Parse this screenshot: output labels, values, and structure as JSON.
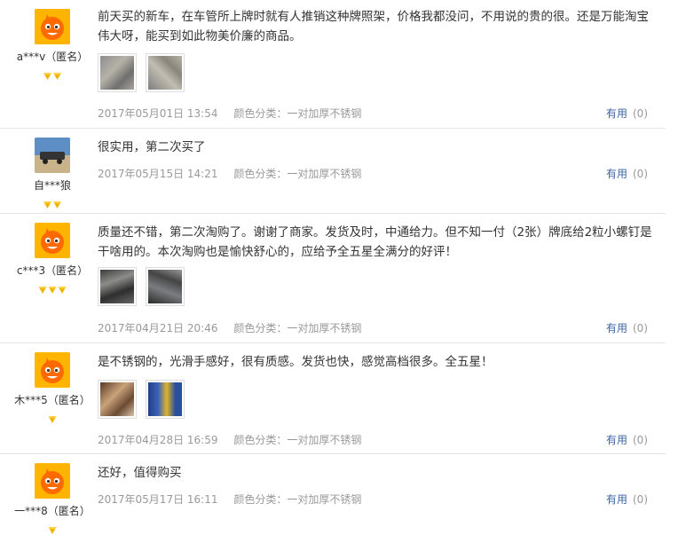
{
  "reviews": [
    {
      "nick": "a***v（匿名）",
      "avatar": "taobao-doll-avatar",
      "level": 2,
      "text": "前天买的新车，在车管所上牌时就有人推销这种牌照架，价格我都没问，不用说的贵的很。还是万能淘宝伟大呀，能买到如此物美价廉的商品。",
      "date": "2017年05月01日 13:54",
      "sku": "颜色分类：一对加厚不锈钢",
      "useful_label": "有用",
      "useful_count": "(0)",
      "images": [
        "grey",
        "grey"
      ]
    },
    {
      "nick": "自***狼",
      "avatar": "car-photo-avatar",
      "level": 2,
      "text": "很实用，第二次买了",
      "date": "2017年05月15日 14:21",
      "sku": "颜色分类：一对加厚不锈钢",
      "useful_label": "有用",
      "useful_count": "(0)",
      "images": []
    },
    {
      "nick": "c***3（匿名）",
      "avatar": "taobao-doll-avatar",
      "level": 3,
      "text": "质量还不错，第二次淘购了。谢谢了商家。发货及时，中通给力。但不知一付（2张）牌底给2粒小螺钉是干啥用的。本次淘购也是愉快舒心的，应给予全五星全满分的好评！",
      "date": "2017年04月21日 20:46",
      "sku": "颜色分类：一对加厚不锈钢",
      "useful_label": "有用",
      "useful_count": "(0)",
      "images": [
        "dark",
        "dark"
      ]
    },
    {
      "nick": "木***5（匿名）",
      "avatar": "taobao-doll-avatar",
      "level": 1,
      "text": "是不锈钢的，光滑手感好，很有质感。发货也快，感觉高档很多。全五星！",
      "date": "2017年04月28日 16:59",
      "sku": "颜色分类：一对加厚不锈钢",
      "useful_label": "有用",
      "useful_count": "(0)",
      "images": [
        "brown",
        "blue"
      ]
    },
    {
      "nick": "一***8（匿名）",
      "avatar": "taobao-doll-avatar",
      "level": 1,
      "text": "还好，值得购买",
      "date": "2017年05月17日 16:11",
      "sku": "颜色分类：一对加厚不锈钢",
      "useful_label": "有用",
      "useful_count": "(0)",
      "images": []
    }
  ]
}
